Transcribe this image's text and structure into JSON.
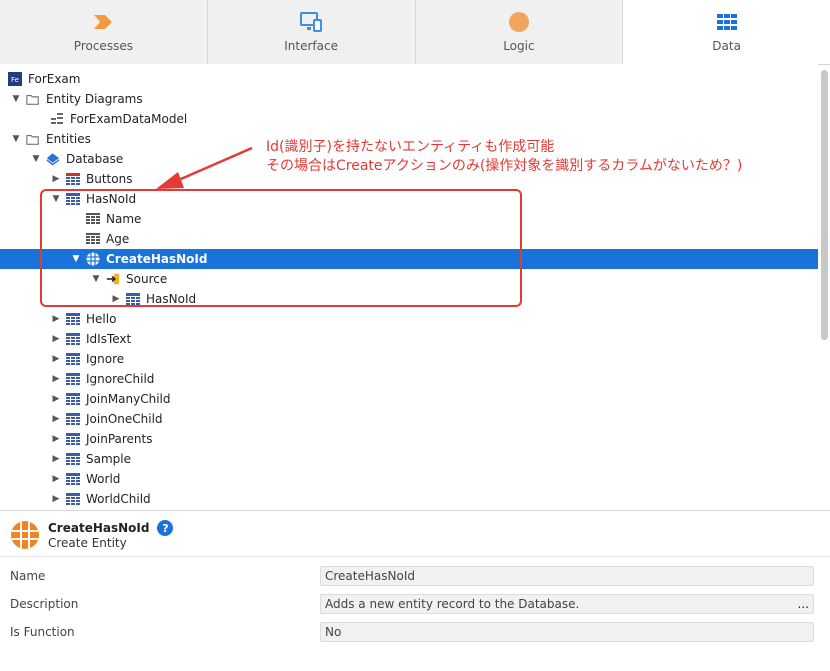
{
  "tabs": [
    {
      "label": "Processes",
      "icon": "processes-icon",
      "color": "#f59a3c"
    },
    {
      "label": "Interface",
      "icon": "interface-icon",
      "color": "#3f8fe0"
    },
    {
      "label": "Logic",
      "icon": "logic-icon",
      "color": "#f2a55c"
    },
    {
      "label": "Data",
      "icon": "data-icon",
      "color": "#1a73d9"
    }
  ],
  "tree": {
    "root": "ForExam",
    "root_badge": "Fe",
    "entity_diagrams": "Entity Diagrams",
    "data_model": "ForExamDataModel",
    "entities": "Entities",
    "database": "Database",
    "buttons": "Buttons",
    "hasnoid": "HasNoId",
    "name_attr": "Name",
    "age_attr": "Age",
    "create_action": "CreateHasNoId",
    "source": "Source",
    "source_entity": "HasNoId",
    "rest": [
      "Hello",
      "IdIsText",
      "Ignore",
      "IgnoreChild",
      "JoinManyChild",
      "JoinOneChild",
      "JoinParents",
      "Sample",
      "World",
      "WorldChild"
    ]
  },
  "annotation": {
    "line1": "Id(識別子)を持たないエンティティも作成可能",
    "line2": "その場合はCreateアクションのみ(操作対象を識別するカラムがないため？)",
    "color": "#e53935"
  },
  "properties": {
    "title": "CreateHasNoId",
    "subtitle": "Create Entity",
    "help": "?",
    "rows": [
      {
        "label": "Name",
        "value": "CreateHasNoId"
      },
      {
        "label": "Description",
        "value": "Adds a new entity record to the Database.",
        "ellipsis": "..."
      },
      {
        "label": "Is Function",
        "value": "No"
      }
    ]
  },
  "colors": {
    "selected": "#1a73d9",
    "entity": "#3a5ca8",
    "folder": "#777777"
  }
}
